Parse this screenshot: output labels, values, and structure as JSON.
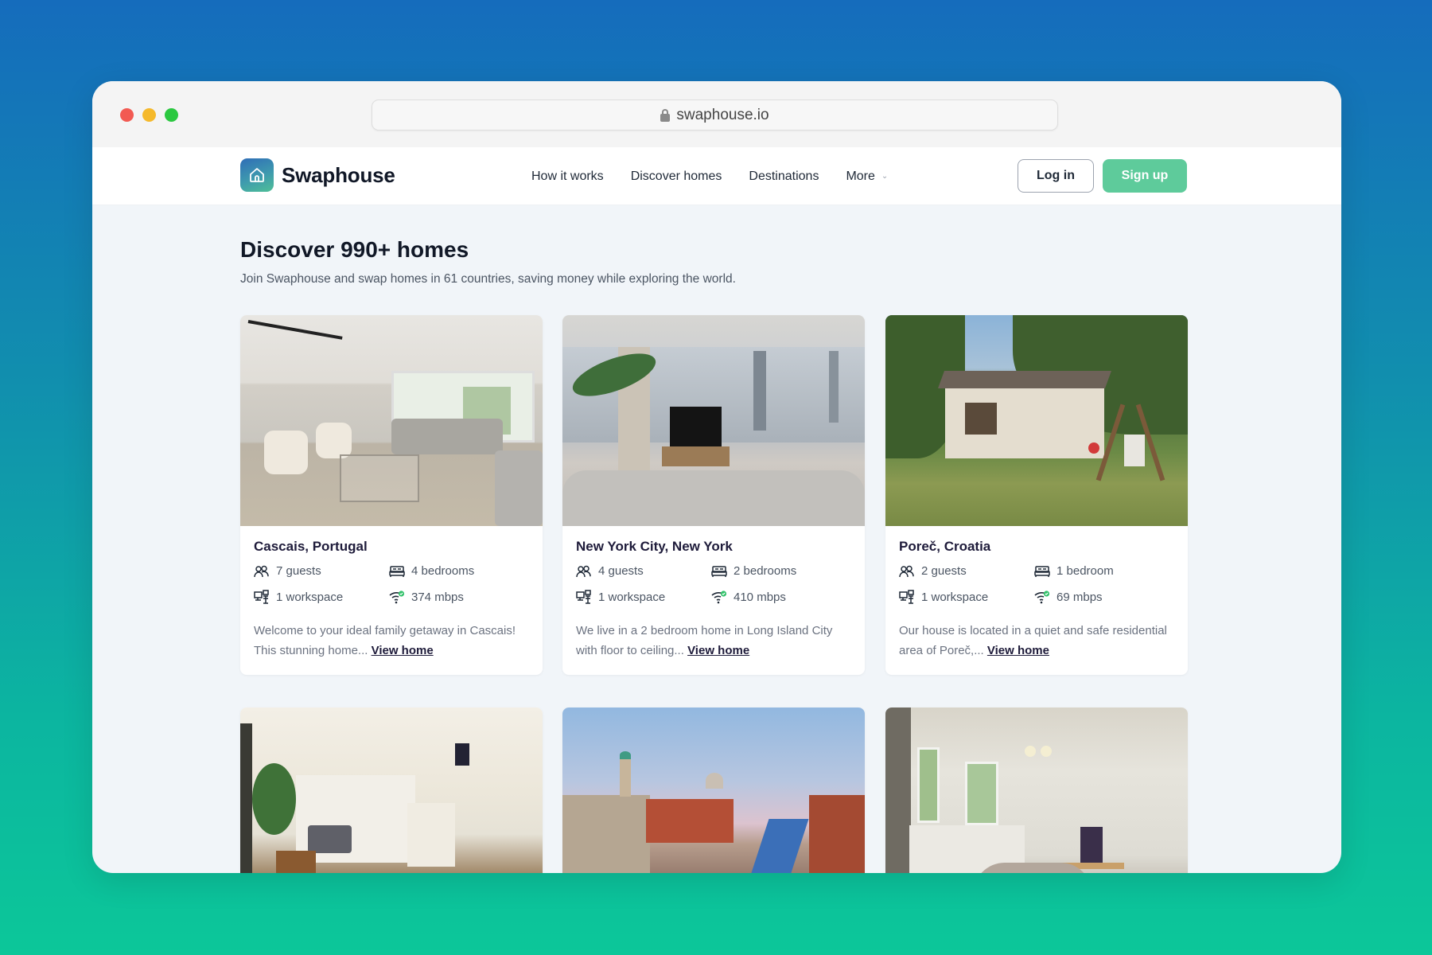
{
  "browser": {
    "url": "swaphouse.io",
    "traffic_lights": {
      "close": "#f25a52",
      "minimize": "#f5b92b",
      "zoom": "#2bc840"
    }
  },
  "nav": {
    "brand": "Swaphouse",
    "links": [
      {
        "label": "How it works"
      },
      {
        "label": "Discover homes"
      },
      {
        "label": "Destinations"
      },
      {
        "label": "More",
        "has_dropdown": true
      }
    ],
    "login_label": "Log in",
    "signup_label": "Sign up",
    "accent_color": "#5ecb9b"
  },
  "hero": {
    "title": "Discover 990+ homes",
    "subtitle": "Join Swaphouse and swap homes in 61 countries, saving money while exploring the world."
  },
  "listings": [
    {
      "title": "Cascais, Portugal",
      "guests": "7 guests",
      "bedrooms": "4 bedrooms",
      "workspace": "1 workspace",
      "wifi": "374 mbps",
      "description": "Welcome to your ideal family getaway in Cascais! This stunning home...",
      "link": "View home",
      "photo": "bright living room with armchairs and sofa"
    },
    {
      "title": "New York City, New York",
      "guests": "4 guests",
      "bedrooms": "2 bedrooms",
      "workspace": "1 workspace",
      "wifi": "410 mbps",
      "description": "We live in a 2 bedroom home in Long Island City with floor to ceiling...",
      "link": "View home",
      "photo": "apartment with floor-to-ceiling windows and city skyline"
    },
    {
      "title": "Poreč, Croatia",
      "guests": "2 guests",
      "bedrooms": "1 bedroom",
      "workspace": "1 workspace",
      "wifi": "69 mbps",
      "description": "Our house is located in a quiet and safe residential area of Poreč,...",
      "link": "View home",
      "photo": "stone house with garden and wooden swing"
    },
    {
      "photo": "small apartment living room with plant"
    },
    {
      "photo": "city skyline with river and church dome"
    },
    {
      "photo": "room with chandelier and windows"
    }
  ],
  "icons": {
    "guests": "users-icon",
    "bedrooms": "bed-icon",
    "workspace": "desk-icon",
    "wifi": "wifi-check-icon"
  }
}
